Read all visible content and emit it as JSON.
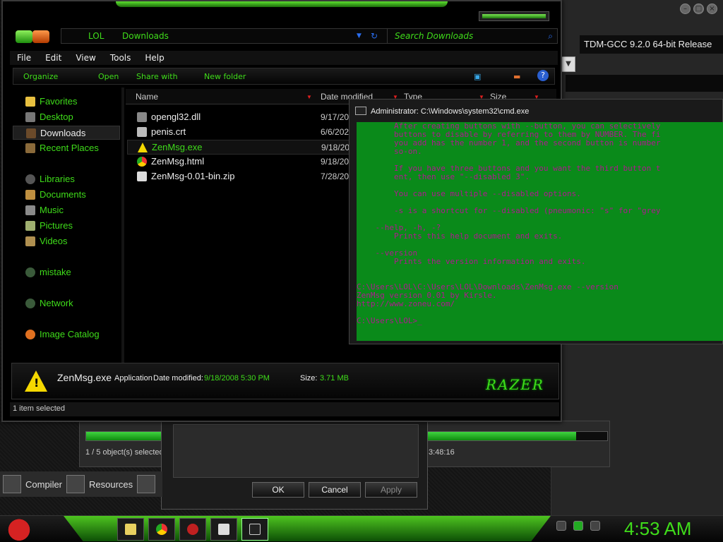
{
  "background": {
    "tdm_title": "TDM-GCC 9.2.0 64-bit Release",
    "copy_status": "1 / 5 object(s) selected",
    "copy_time": "3:48:16",
    "copy_progress": 0.94,
    "ide_tabs": [
      "Compiler",
      "Resources"
    ]
  },
  "dialog": {
    "ok": "OK",
    "cancel": "Cancel",
    "apply": "Apply"
  },
  "explorer": {
    "breadcrumb": [
      "LOL",
      "Downloads"
    ],
    "search_placeholder": "Search Downloads",
    "menu": [
      "File",
      "Edit",
      "View",
      "Tools",
      "Help"
    ],
    "commands": [
      "Organize",
      "Open",
      "Share with",
      "New folder"
    ],
    "sidebar": [
      {
        "label": "Favorites",
        "icon": "star-icon"
      },
      {
        "label": "Desktop",
        "icon": "desktop-icon"
      },
      {
        "label": "Downloads",
        "icon": "downloads-icon",
        "selected": true
      },
      {
        "label": "Recent Places",
        "icon": "recent-places-icon"
      },
      {
        "label": "Libraries",
        "icon": "libraries-icon"
      },
      {
        "label": "Documents",
        "icon": "documents-icon"
      },
      {
        "label": "Music",
        "icon": "music-icon"
      },
      {
        "label": "Pictures",
        "icon": "pictures-icon"
      },
      {
        "label": "Videos",
        "icon": "videos-icon"
      },
      {
        "label": "mistake",
        "icon": "homegroup-icon"
      },
      {
        "label": "Network",
        "icon": "network-icon"
      },
      {
        "label": "Image Catalog",
        "icon": "image-catalog-icon"
      }
    ],
    "columns": [
      "Name",
      "Date modified",
      "Type",
      "Size"
    ],
    "files": [
      {
        "name": "opengl32.dll",
        "date": "9/17/20",
        "icon": "dll-file-icon"
      },
      {
        "name": "penis.crt",
        "date": "6/6/202",
        "icon": "certificate-file-icon"
      },
      {
        "name": "ZenMsg.exe",
        "date": "9/18/20",
        "icon": "warning-exe-icon",
        "selected": true
      },
      {
        "name": "ZenMsg.html",
        "date": "9/18/20",
        "icon": "chrome-html-icon"
      },
      {
        "name": "ZenMsg-0.01-bin.zip",
        "date": "7/28/20",
        "icon": "zip-file-icon"
      }
    ],
    "details": {
      "name": "ZenMsg.exe",
      "type": "Application",
      "date_label": "Date modified:",
      "date_value": "9/18/2008 5:30 PM",
      "size_label": "Size:",
      "size_value": "3.71 MB",
      "brand": "RAZER"
    },
    "status": "1 item selected"
  },
  "cmd": {
    "title": "Administrator: C:\\Windows\\system32\\cmd.exe",
    "lines": [
      "        After creating buttons with --button, you can selectively",
      "        buttons to disable by referring to them by NUMBER. The fi",
      "        you add has the number 1, and the second button is number",
      "        so-on.",
      "",
      "        If you have three buttons and you want the third button t",
      "        ent, then use \"--disabled 3\".",
      "",
      "        You can use multiple --disabled options.",
      "",
      "        -s is a shortcut for --disabled (pneumonic: \"s\" for \"grey",
      "",
      "    --help, -h, -?",
      "        Prints this help document and exits.",
      "",
      "    --version",
      "        Prints the version information and exits.",
      "",
      "",
      "C:\\Users\\LOL\\C:\\Users\\LOL\\Downloads\\ZenMsg.exe --version",
      "ZenMsg version 0.01 by Kirsle.",
      "http://www.zoneu.com/",
      "",
      "C:\\Users\\LOL>_"
    ]
  },
  "taskbar": {
    "clock": "4:53 AM",
    "apps": [
      "explorer-icon",
      "chrome-icon",
      "devcpp-icon",
      "7zip-icon",
      "cmd-icon"
    ]
  },
  "colors": {
    "accent_green": "#3fdc1a",
    "console_bg": "#0a8a1a",
    "console_text": "#b01890"
  }
}
